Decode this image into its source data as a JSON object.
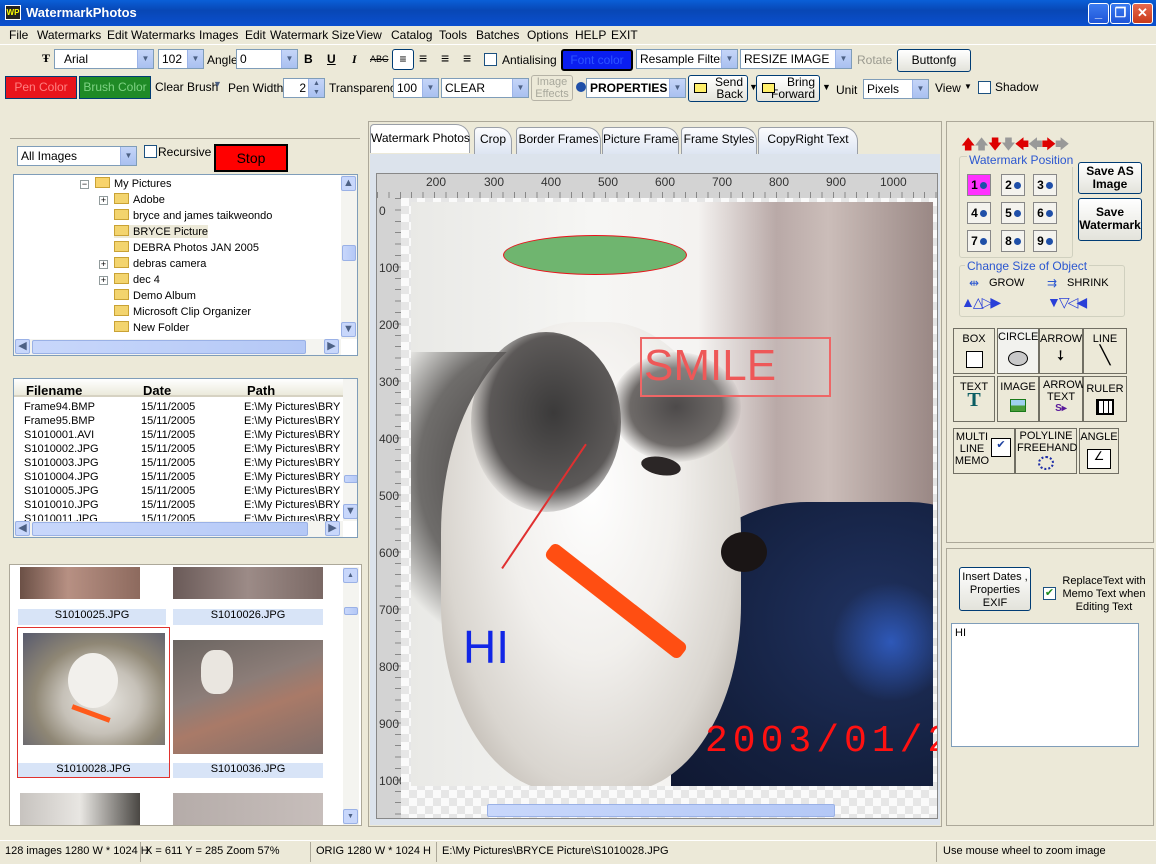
{
  "window": {
    "title": "WatermarkPhotos"
  },
  "menu": [
    "File",
    "Watermarks",
    "Edit Watermarks",
    "Images",
    "Edit",
    "Watermark Size",
    "View",
    "Catalog",
    "Tools",
    "Batches",
    "Options",
    "HELP",
    "EXIT"
  ],
  "toolbar1": {
    "font_name": "Arial",
    "font_size": "102",
    "angle_label": "Angle",
    "angle_value": "0",
    "bold": "B",
    "underline": "U",
    "italic": "I",
    "strike": "ABC",
    "antialias_label": "Antialising",
    "font_color_label": "Font color",
    "resample_label": "Resample Filters",
    "resize_label": "RESIZE IMAGE",
    "rotate_label": "Rotate",
    "buttonfg_label": "Buttonfg"
  },
  "toolbar2": {
    "pen_color_label": "Pen Color",
    "brush_color_label": "Brush Color",
    "clear_brush_label": "Clear Brush",
    "pen_width_label": "Pen Width",
    "pen_width_value": "2",
    "transparency_label": "Transparency",
    "transparency_value": "100",
    "mode_value": "CLEAR",
    "image_effects_label": "Image Effects",
    "properties_label": "PROPERTIES",
    "send_back_label": "Send Back",
    "bring_forward_label": "Bring Forward",
    "unit_label": "Unit",
    "unit_value": "Pixels",
    "view_label": "View",
    "shadow_label": "Shadow",
    "pen_color": "#e8141b",
    "brush_color": "#1f8a26",
    "font_color": "#0a1ef0"
  },
  "browser": {
    "filter_value": "All Images",
    "recursive_label": "Recursive",
    "stop_label": "Stop",
    "tree": [
      {
        "label": "My Pictures",
        "toggle": "−"
      },
      {
        "label": "Adobe",
        "toggle": "+"
      },
      {
        "label": "bryce and james taikweondo",
        "toggle": ""
      },
      {
        "label": "BRYCE Picture",
        "toggle": ""
      },
      {
        "label": "DEBRA Photos JAN 2005",
        "toggle": ""
      },
      {
        "label": "debras camera",
        "toggle": "+"
      },
      {
        "label": "dec 4",
        "toggle": "+"
      },
      {
        "label": "Demo Album",
        "toggle": ""
      },
      {
        "label": "Microsoft Clip Organizer",
        "toggle": ""
      },
      {
        "label": "New Folder",
        "toggle": ""
      }
    ],
    "file_columns": [
      "Filename",
      "Date",
      "Path"
    ],
    "files": [
      [
        "Frame94.BMP",
        "15/11/2005",
        "E:\\My Pictures\\BRY"
      ],
      [
        "Frame95.BMP",
        "15/11/2005",
        "E:\\My Pictures\\BRY"
      ],
      [
        "S1010001.AVI",
        "15/11/2005",
        "E:\\My Pictures\\BRY"
      ],
      [
        "S1010002.JPG",
        "15/11/2005",
        "E:\\My Pictures\\BRY"
      ],
      [
        "S1010003.JPG",
        "15/11/2005",
        "E:\\My Pictures\\BRY"
      ],
      [
        "S1010004.JPG",
        "15/11/2005",
        "E:\\My Pictures\\BRY"
      ],
      [
        "S1010005.JPG",
        "15/11/2005",
        "E:\\My Pictures\\BRY"
      ],
      [
        "S1010010.JPG",
        "15/11/2005",
        "E:\\My Pictures\\BRY"
      ],
      [
        "S1010011.JPG",
        "15/11/2005",
        "E:\\My Pictures\\BRY"
      ]
    ],
    "thumbs": [
      "S1010025.JPG",
      "S1010026.JPG",
      "S1010028.JPG",
      "S1010036.JPG"
    ]
  },
  "tabs": [
    "Watermark Photos",
    "Crop",
    "Border Frames",
    "Picture Frame",
    "Frame Styles",
    "CopyRight Text"
  ],
  "canvas": {
    "ruler_h": [
      "200",
      "300",
      "400",
      "500",
      "600",
      "700",
      "800",
      "900",
      "1000"
    ],
    "ruler_v": [
      "0",
      "100",
      "200",
      "300",
      "400",
      "500",
      "600",
      "700",
      "800",
      "900",
      "1000"
    ],
    "text_smile": "SMILE",
    "text_hi": "HI",
    "text_date": "2003/01/2"
  },
  "right": {
    "position_label": "Watermark Position",
    "positions": [
      "1",
      "2",
      "3",
      "4",
      "5",
      "6",
      "7",
      "8",
      "9"
    ],
    "save_as_label": "Save AS Image",
    "save_wm_label": "Save Watermark",
    "change_size_label": "Change Size of Object",
    "grow_label": "GROW",
    "shrink_label": "SHRINK",
    "tools": [
      "BOX",
      "CIRCLE",
      "ARROW",
      "LINE",
      "TEXT",
      "IMAGE",
      "ARROW TEXT",
      "RULER",
      "MULTI LINE MEMO",
      "POLYLINE FREEHAND",
      "ANGLE"
    ],
    "insert_dates_label": "Insert Dates , Properties EXIF",
    "replace_text_label": "ReplaceText with Memo Text when Editing Text",
    "memo_text": "HI"
  },
  "status": {
    "images": "128 images 1280 W * 1024 H",
    "coords": "X = 611 Y = 285 Zoom 57%",
    "orig": "ORIG  1280 W * 1024 H",
    "path": "E:\\My Pictures\\BRYCE Picture\\S1010028.JPG",
    "hint": "Use mouse wheel to zoom image"
  }
}
